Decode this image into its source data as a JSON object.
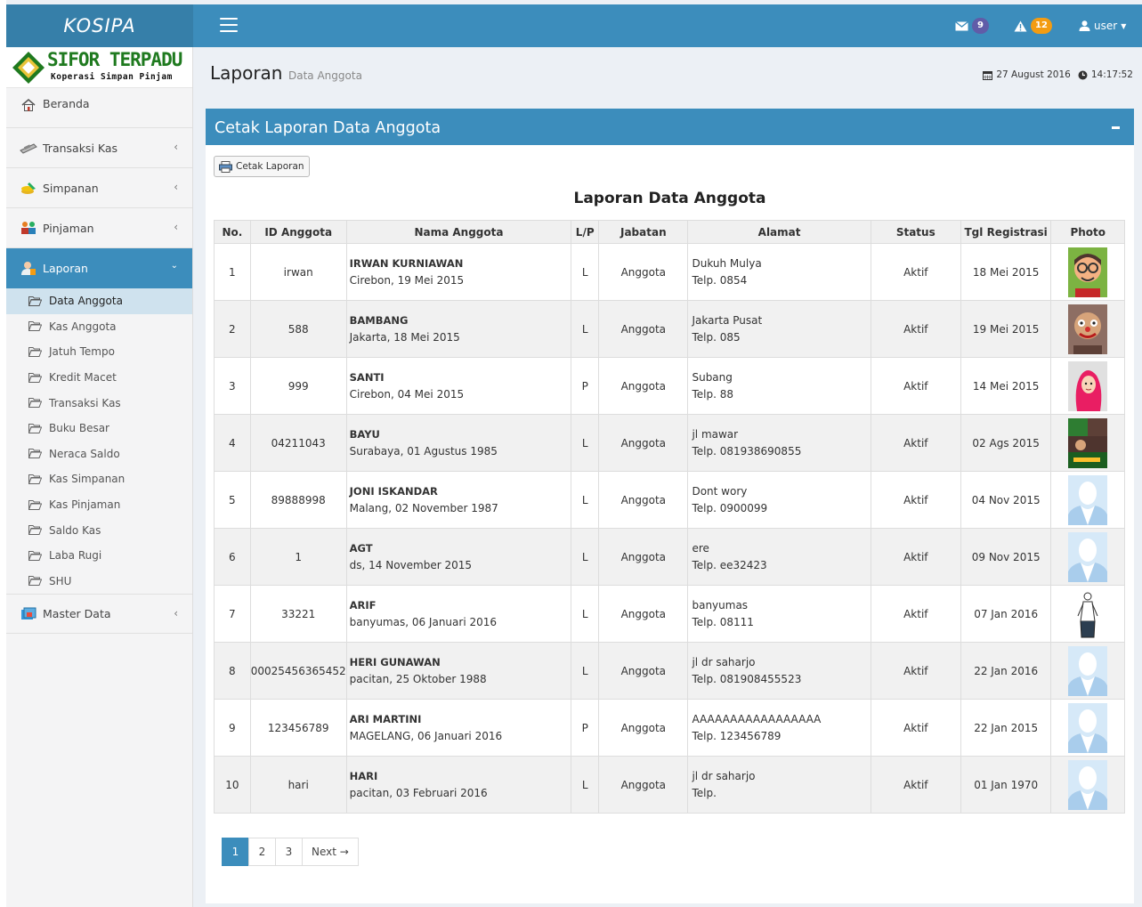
{
  "app": {
    "logo": "KOSIPA"
  },
  "topbar": {
    "mail_count": "9",
    "alert_count": "12",
    "user_label": "user"
  },
  "brand": {
    "title": "SIFOR TERPADU",
    "subtitle": "Koperasi Simpan Pinjam"
  },
  "sidebar": {
    "items": [
      {
        "label": "Beranda"
      },
      {
        "label": "Transaksi Kas"
      },
      {
        "label": "Simpanan"
      },
      {
        "label": "Pinjaman"
      },
      {
        "label": "Laporan"
      },
      {
        "label": "Master Data"
      }
    ],
    "laporan_sub": [
      {
        "label": "Data Anggota"
      },
      {
        "label": "Kas Anggota"
      },
      {
        "label": "Jatuh Tempo"
      },
      {
        "label": "Kredit Macet"
      },
      {
        "label": "Transaksi Kas"
      },
      {
        "label": "Buku Besar"
      },
      {
        "label": "Neraca Saldo"
      },
      {
        "label": "Kas Simpanan"
      },
      {
        "label": "Kas Pinjaman"
      },
      {
        "label": "Saldo Kas"
      },
      {
        "label": "Laba Rugi"
      },
      {
        "label": "SHU"
      }
    ]
  },
  "header": {
    "title": "Laporan",
    "subtitle": "Data Anggota",
    "date": "27 August 2016",
    "time": "14:17:52"
  },
  "box": {
    "title": "Cetak Laporan Data Anggota",
    "print_button": "Cetak Laporan",
    "report_title": "Laporan Data Anggota"
  },
  "table": {
    "columns": [
      "No.",
      "ID Anggota",
      "Nama Anggota",
      "L/P",
      "Jabatan",
      "Alamat",
      "Status",
      "Tgl Registrasi",
      "Photo"
    ],
    "rows": [
      {
        "no": "1",
        "id": "irwan",
        "name": "IRWAN KURNIAWAN",
        "ttl": "Cirebon, 19 Mei 2015",
        "lp": "L",
        "jabatan": "Anggota",
        "alamat": "Dukuh Mulya",
        "telp": "Telp. 0854",
        "status": "Aktif",
        "tgl": "18 Mei 2015",
        "photo": "cartoon-face"
      },
      {
        "no": "2",
        "id": "588",
        "name": "BAMBANG",
        "ttl": "Jakarta, 18 Mei 2015",
        "lp": "L",
        "jabatan": "Anggota",
        "alamat": "Jakarta Pusat",
        "telp": "Telp. 085",
        "status": "Aktif",
        "tgl": "19 Mei 2015",
        "photo": "clown-face"
      },
      {
        "no": "3",
        "id": "999",
        "name": "SANTI",
        "ttl": "Cirebon, 04 Mei 2015",
        "lp": "P",
        "jabatan": "Anggota",
        "alamat": "Subang",
        "telp": "Telp. 88",
        "status": "Aktif",
        "tgl": "14 Mei 2015",
        "photo": "woman-hijab"
      },
      {
        "no": "4",
        "id": "04211043",
        "name": "BAYU",
        "ttl": "Surabaya, 01 Agustus 1985",
        "lp": "L",
        "jabatan": "Anggota",
        "alamat": "jl mawar",
        "telp": "Telp. 081938690855",
        "status": "Aktif",
        "tgl": "02 Ags 2015",
        "photo": "collage"
      },
      {
        "no": "5",
        "id": "89888998",
        "name": "JONI ISKANDAR",
        "ttl": "Malang, 02 November 1987",
        "lp": "L",
        "jabatan": "Anggota",
        "alamat": "Dont wory",
        "telp": "Telp. 0900099",
        "status": "Aktif",
        "tgl": "04 Nov 2015",
        "photo": "default-avatar"
      },
      {
        "no": "6",
        "id": "1",
        "name": "AGT",
        "ttl": "ds, 14 November 2015",
        "lp": "L",
        "jabatan": "Anggota",
        "alamat": "ere",
        "telp": "Telp. ee32423",
        "status": "Aktif",
        "tgl": "09 Nov 2015",
        "photo": "default-avatar"
      },
      {
        "no": "7",
        "id": "33221",
        "name": "ARIF",
        "ttl": "banyumas, 06 Januari 2016",
        "lp": "L",
        "jabatan": "Anggota",
        "alamat": "banyumas",
        "telp": "Telp. 08111",
        "status": "Aktif",
        "tgl": "07 Jan 2016",
        "photo": "figure-sketch"
      },
      {
        "no": "8",
        "id": "00025456365452",
        "name": "HERI GUNAWAN",
        "ttl": "pacitan, 25 Oktober 1988",
        "lp": "L",
        "jabatan": "Anggota",
        "alamat": "jl dr saharjo",
        "telp": "Telp. 081908455523",
        "status": "Aktif",
        "tgl": "22 Jan 2016",
        "photo": "default-avatar"
      },
      {
        "no": "9",
        "id": "123456789",
        "name": "ARI MARTINI",
        "ttl": "MAGELANG, 06 Januari 2016",
        "lp": "P",
        "jabatan": "Anggota",
        "alamat": "AAAAAAAAAAAAAAAAA",
        "telp": "Telp. 123456789",
        "status": "Aktif",
        "tgl": "22 Jan 2015",
        "photo": "default-avatar"
      },
      {
        "no": "10",
        "id": "hari",
        "name": "HARI",
        "ttl": "pacitan, 03 Februari 2016",
        "lp": "L",
        "jabatan": "Anggota",
        "alamat": "jl dr saharjo",
        "telp": "Telp.",
        "status": "Aktif",
        "tgl": "01 Jan 1970",
        "photo": "default-avatar"
      }
    ]
  },
  "pagination": {
    "pages": [
      "1",
      "2",
      "3"
    ],
    "current": "1",
    "next": "Next →"
  },
  "colors": {
    "primary": "#3c8dbc",
    "primary_dark": "#367fa9",
    "badge_mail": "#605ca8",
    "badge_alert": "#f39c12",
    "brand_green": "#1f7a1f"
  }
}
